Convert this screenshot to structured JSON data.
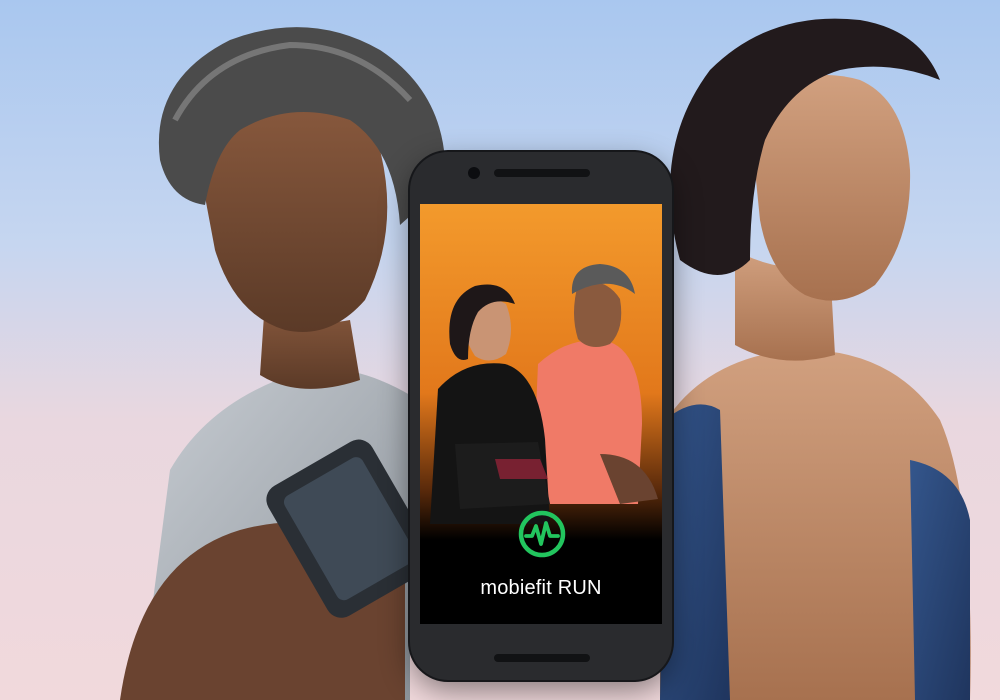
{
  "brand": {
    "name": "mobiefit RUN",
    "logo_color": "#22c55e"
  },
  "scene": {
    "background_top": "#a9c7ef",
    "background_bottom": "#f1d9dc",
    "app_screen_gradient_top": "#f39a2c"
  }
}
